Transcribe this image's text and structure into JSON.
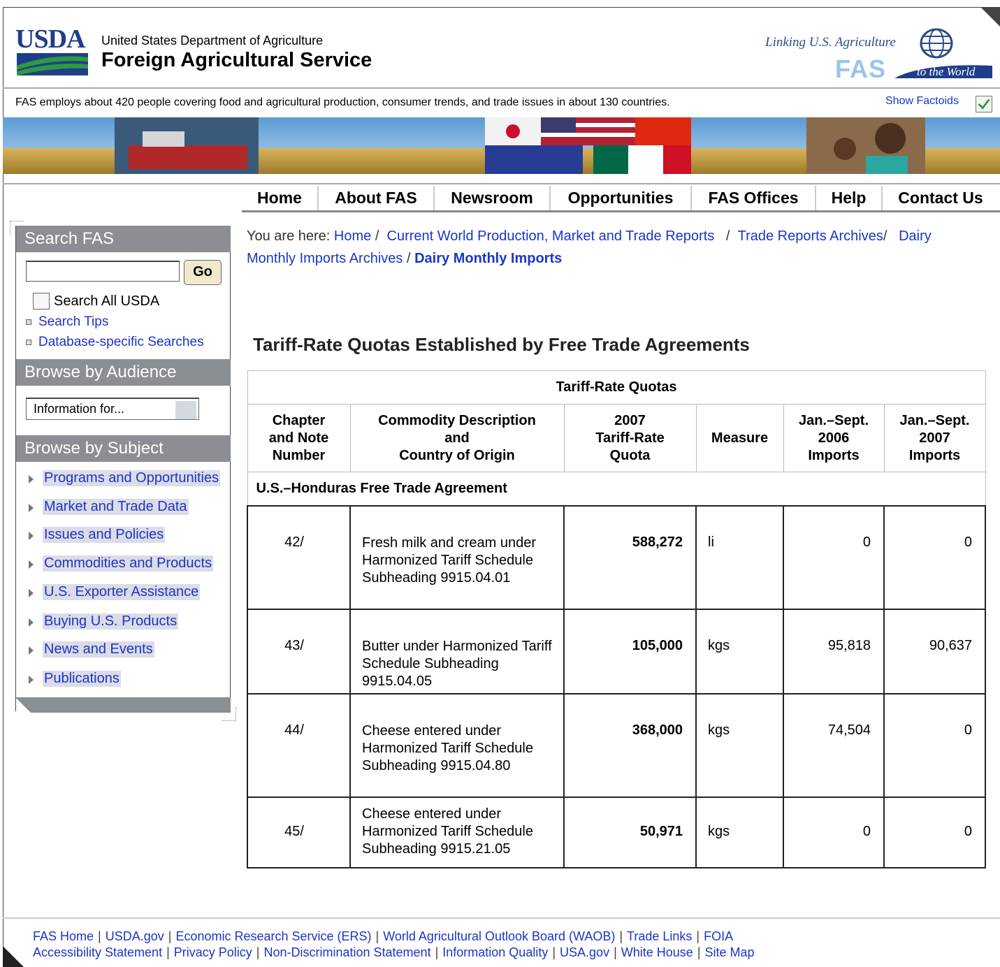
{
  "header": {
    "logo_text": "USDA",
    "department": "United States Department of Agriculture",
    "service": "Foreign Agricultural Service",
    "tagline": "Linking U.S. Agriculture",
    "fas_logo": "FAS",
    "tagline_end": "to the World"
  },
  "factoid": {
    "text": "FAS employs about 420 people covering food and agricultural production, consumer trends, and trade issues in about 130 countries.",
    "toggle_label": "Show Factoids"
  },
  "nav": {
    "items": [
      "Home",
      "About FAS",
      "Newsroom",
      "Opportunities",
      "FAS Offices",
      "Help",
      "Contact Us"
    ]
  },
  "sidebar": {
    "search_heading": "Search FAS",
    "search_placeholder": "",
    "go_label": "Go",
    "search_all_label": "Search All USDA",
    "links": [
      "Search Tips",
      "Database-specific Searches"
    ],
    "audience_heading": "Browse by Audience",
    "audience_select": "Information for...",
    "subject_heading": "Browse by Subject",
    "subjects": [
      "Programs and Opportunities",
      "Market and Trade Data",
      "Issues and Policies",
      "Commodities and Products",
      "U.S. Exporter Assistance",
      "Buying U.S. Products",
      "News and Events",
      "Publications"
    ]
  },
  "breadcrumb": {
    "prefix": "You are here:",
    "items": [
      "Home",
      "Current World Production, Market and Trade Reports",
      "Trade Reports",
      "Archives",
      "Dairy Monthly Imports Archives"
    ],
    "current": "Dairy Monthly Imports"
  },
  "page_title": "Tariff-Rate Quotas Established by Free Trade Agreements",
  "table": {
    "caption": "Tariff-Rate Quotas",
    "headers": {
      "chapter": [
        "Chapter",
        "and Note",
        "Number"
      ],
      "commodity": [
        "Commodity Description",
        "and",
        "Country of Origin"
      ],
      "quota": [
        "2007",
        "Tariff-Rate",
        "Quota"
      ],
      "measure": "Measure",
      "imp2006": [
        "Jan.–Sept.",
        "2006",
        "Imports"
      ],
      "imp2007": [
        "Jan.–Sept.",
        "2007",
        "Imports"
      ]
    },
    "agreement": "U.S.–Honduras Free Trade Agreement",
    "rows": [
      {
        "note": "42/",
        "desc": "Fresh milk and cream under Harmonized Tariff Schedule Subheading 9915.04.01",
        "quota": "588,272",
        "measure": "li",
        "imp2006": "0",
        "imp2007": "0"
      },
      {
        "note": "43/",
        "desc": "Butter under Harmonized Tariff Schedule Subheading 9915.04.05",
        "quota": "105,000",
        "measure": "kgs",
        "imp2006": "95,818",
        "imp2007": "90,637"
      },
      {
        "note": "44/",
        "desc": "Cheese entered under Harmonized Tariff Schedule Subheading 9915.04.80",
        "quota": "368,000",
        "measure": "kgs",
        "imp2006": "74,504",
        "imp2007": "0"
      },
      {
        "note": "45/",
        "desc": "Cheese entered under Harmonized Tariff Schedule Subheading 9915.21.05",
        "quota": "50,971",
        "measure": "kgs",
        "imp2006": "0",
        "imp2007": "0"
      }
    ]
  },
  "footer": {
    "line1": [
      "FAS Home",
      "USDA.gov",
      "Economic Research Service (ERS)",
      "World Agricultural Outlook Board (WAOB)",
      "Trade Links",
      "FOIA"
    ],
    "line2": [
      "Accessibility Statement",
      "Privacy Policy",
      "Non-Discrimination Statement",
      "Information Quality",
      "USA.gov",
      "White House",
      "Site Map"
    ]
  },
  "colors": {
    "link": "#1a35c8",
    "sidebar_heading": "#8b8e92",
    "subject_highlight": "#dcdce6",
    "usda_blue": "#1f3e8a"
  }
}
